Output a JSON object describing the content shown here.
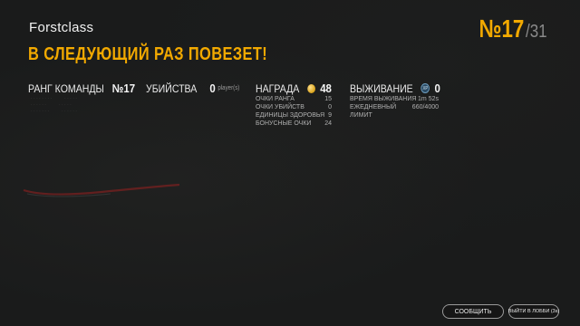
{
  "player_name": "Forstclass",
  "result_message": "В СЛЕДУЮЩИЙ РАЗ ПОВЕЗЕТ!",
  "rank": {
    "number": "№17",
    "total": "/31"
  },
  "team_rank": {
    "label": "РАНГ КОМАНДЫ",
    "value": "№17"
  },
  "kills": {
    "label": "УБИЙСТВА",
    "value": "0",
    "unit": "player(s)"
  },
  "reward": {
    "label": "НАГРАДА",
    "value": "48",
    "rows": [
      {
        "label": "ОЧКИ РАНГА",
        "value": "15"
      },
      {
        "label": "ОЧКИ УБИЙСТВ",
        "value": "0"
      },
      {
        "label": "ЕДИНИЦЫ ЗДОРОВЬЯ",
        "value": "9"
      },
      {
        "label": "БОНУСНЫЕ ОЧКИ",
        "value": "24"
      }
    ]
  },
  "survival": {
    "label": "ВЫЖИВАНИЕ",
    "value": "0",
    "badge": "XP",
    "rows": [
      {
        "label": "ВРЕМЯ ВЫЖИВАНИЯ",
        "value": "1m 52s"
      },
      {
        "label": "ЕЖЕДНЕВНЫЙ ЛИМИТ",
        "value": "660/4000"
      }
    ]
  },
  "buttons": {
    "report": "СООБЩИТЬ",
    "exit_lobby": "ВЫЙТИ В ЛОББИ (3s)"
  },
  "icons": {
    "reward_coin": "coin-icon",
    "survival_badge": "survival-xp-icon"
  },
  "colors": {
    "accent": "#f2a900",
    "background": "#1b1c1c",
    "muted": "#8a8a8a"
  }
}
